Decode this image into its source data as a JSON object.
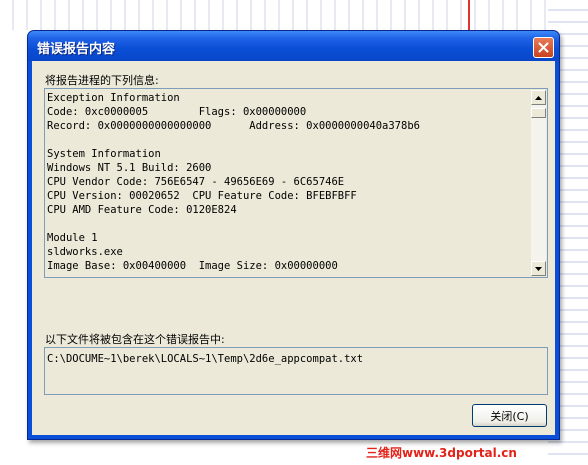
{
  "window": {
    "title": "错误报告内容",
    "close_icon": "close-icon"
  },
  "report": {
    "label": "将报告进程的下列信息:",
    "lines": [
      "Exception Information",
      "Code: 0xc0000005        Flags: 0x00000000",
      "Record: 0x0000000000000000      Address: 0x0000000040a378b6",
      "",
      "System Information",
      "Windows NT 5.1 Build: 2600",
      "CPU Vendor Code: 756E6547 - 49656E69 - 6C65746E",
      "CPU Version: 00020652  CPU Feature Code: BFEBFBFF",
      "CPU AMD Feature Code: 0120E824",
      "",
      "Module 1",
      "sldworks.exe",
      "Image Base: 0x00400000  Image Size: 0x00000000"
    ]
  },
  "files": {
    "label": "以下文件将被包含在这个错误报告中:",
    "path": "C:\\DOCUME~1\\berek\\LOCALS~1\\Temp\\2d6e_appcompat.txt"
  },
  "buttons": {
    "close_label": "关闭(C)"
  },
  "watermark": "三维网www.3dportal.cn",
  "colors": {
    "titlebar": "#0b4fd8",
    "client": "#ece9d8",
    "watermark": "#e2231a"
  }
}
